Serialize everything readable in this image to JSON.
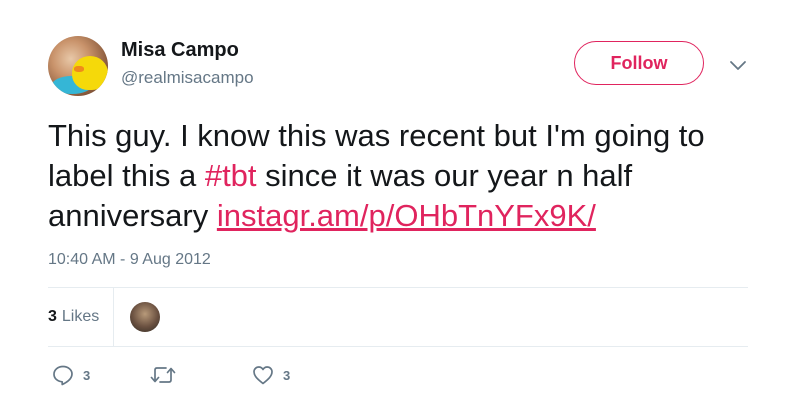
{
  "user": {
    "name": "Misa Campo",
    "handle": "@realmisacampo"
  },
  "follow_button": {
    "label": "Follow"
  },
  "tweet": {
    "text_before": "This guy. I know this was recent but I'm going to label this a ",
    "hashtag": "#tbt",
    "text_after": " since it was our year n half anniversary ",
    "link": "instagr.am/p/OHbTnYFx9K/",
    "timestamp": "10:40 AM - 9 Aug 2012"
  },
  "stats": {
    "likes_count": "3",
    "likes_label": "Likes"
  },
  "actions": {
    "reply_count": "3",
    "retweet_count": "",
    "like_count": "3"
  },
  "icons": {
    "avatar": "profile-photo",
    "caret": "chevron-down-icon",
    "reply": "reply-icon",
    "retweet": "retweet-icon",
    "like": "heart-icon"
  },
  "colors": {
    "accent": "#e0245e",
    "text": "#14171a",
    "secondary": "#657786",
    "divider": "#e6ecf0"
  }
}
